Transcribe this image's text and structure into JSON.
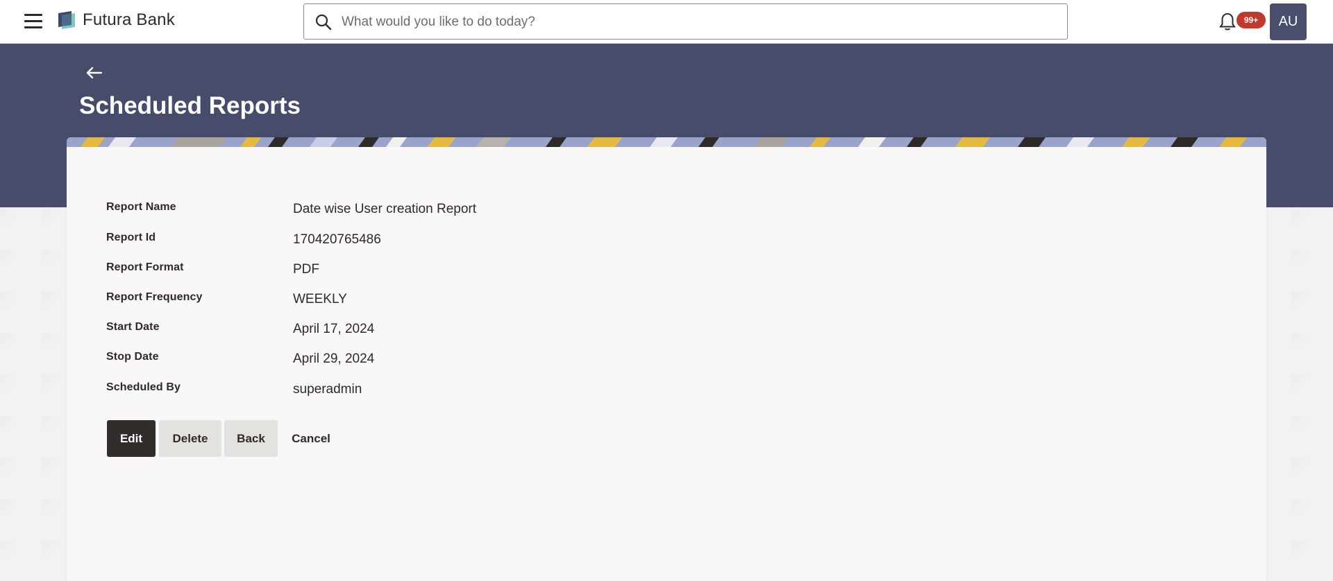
{
  "header": {
    "brand": "Futura Bank",
    "search_placeholder": "What would you like to do today?",
    "notification_count": "99+",
    "avatar_initials": "AU"
  },
  "page": {
    "title": "Scheduled Reports"
  },
  "details": [
    {
      "label": "Report Name",
      "value": "Date wise User creation Report"
    },
    {
      "label": "Report Id",
      "value": "170420765486"
    },
    {
      "label": "Report Format",
      "value": "PDF"
    },
    {
      "label": "Report Frequency",
      "value": "WEEKLY"
    },
    {
      "label": "Start Date",
      "value": "April 17, 2024"
    },
    {
      "label": "Stop Date",
      "value": "April 29, 2024"
    },
    {
      "label": "Scheduled By",
      "value": "superadmin"
    }
  ],
  "actions": {
    "edit": "Edit",
    "delete": "Delete",
    "back": "Back",
    "cancel": "Cancel"
  },
  "colors": {
    "hero": "#474c6b",
    "primary_button": "#312d2a",
    "badge": "#c0392b",
    "avatar": "#4a4d6b"
  },
  "icons": {
    "menu": "hamburger-icon",
    "logo": "bank-logo",
    "search": "search-icon",
    "notifications": "bell-icon",
    "back": "arrow-left-icon"
  }
}
